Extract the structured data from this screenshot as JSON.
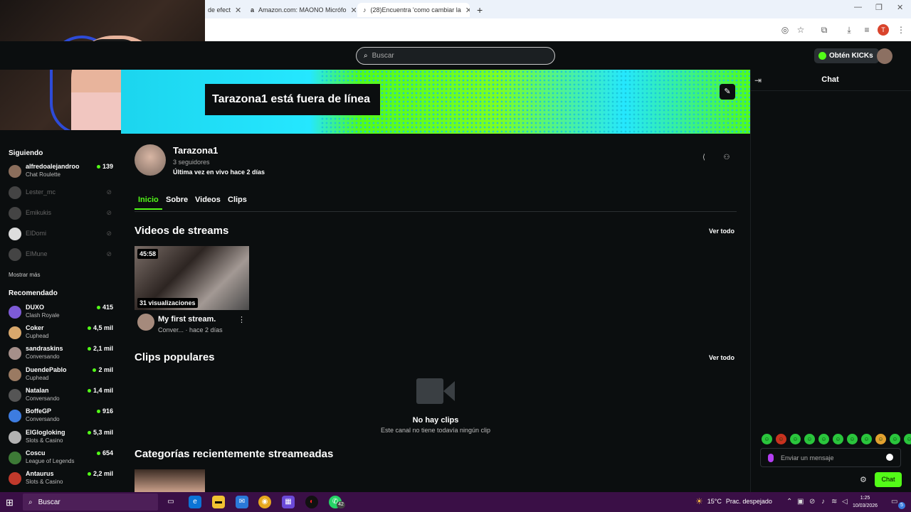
{
  "browser": {
    "tabs": [
      {
        "label": "de efect"
      },
      {
        "label": "Amazon.com: MAONO Micrófo"
      },
      {
        "label": "(28)Encuentra 'como cambiar la"
      }
    ],
    "new_tab": "+"
  },
  "header": {
    "search_placeholder": "Buscar",
    "kicks_label": "Obtén KICKs"
  },
  "banner": {
    "offline_text": "Tarazona1 está fuera de línea"
  },
  "sidebar": {
    "following_title": "Siguiendo",
    "following": [
      {
        "name": "alfredoalejandroo",
        "category": "Chat Roulette",
        "viewers": "139",
        "live": true
      },
      {
        "name": "Lester_mc",
        "live": false
      },
      {
        "name": "Emikukis",
        "live": false
      },
      {
        "name": "ElDomi",
        "live": false
      },
      {
        "name": "ElMune",
        "live": false
      }
    ],
    "show_more": "Mostrar más",
    "recommended_title": "Recomendado",
    "recommended": [
      {
        "name": "DUXO",
        "category": "Clash Royale",
        "viewers": "415"
      },
      {
        "name": "Coker",
        "category": "Cuphead",
        "viewers": "4,5 mil"
      },
      {
        "name": "sandraskins",
        "category": "Conversando",
        "viewers": "2,1 mil"
      },
      {
        "name": "DuendePablo",
        "category": "Cuphead",
        "viewers": "2 mil"
      },
      {
        "name": "Natalan",
        "category": "Conversando",
        "viewers": "1,4 mil"
      },
      {
        "name": "BoffeGP",
        "category": "Conversando",
        "viewers": "916"
      },
      {
        "name": "ElGlogloking",
        "category": "Slots & Casino",
        "viewers": "5,3 mil"
      },
      {
        "name": "Coscu",
        "category": "League of Legends",
        "viewers": "654"
      },
      {
        "name": "Antaurus",
        "category": "Slots & Casino",
        "viewers": "2,2 mil"
      }
    ]
  },
  "profile": {
    "name": "Tarazona1",
    "followers": "3 seguidores",
    "last_live": "Última vez en vivo hace 2 días"
  },
  "tabs": [
    "Inicio",
    "Sobre",
    "Videos",
    "Clips"
  ],
  "streams_section": {
    "title": "Videos de streams",
    "see_all": "Ver todo",
    "video": {
      "duration": "45:58",
      "views": "31 visualizaciones",
      "title": "My first stream.",
      "category": "Conver...",
      "time": "· hace 2 días"
    }
  },
  "clips_section": {
    "title": "Clips populares",
    "see_all": "Ver todo",
    "empty_title": "No hay clips",
    "empty_sub": "Este canal no tiene todavía ningún clip"
  },
  "categories_section": {
    "title": "Categorías recientemente streameadas"
  },
  "chat": {
    "title": "Chat",
    "input_placeholder": "Enviar un mensaje",
    "send_label": "Chat"
  },
  "taskbar": {
    "search_label": "Buscar",
    "badge_count": "42",
    "temperature": "15°C",
    "weather": "Prac. despejado",
    "time": "1:25",
    "date": "10/03/2026",
    "notifications": "5"
  },
  "colors": {
    "accent": "#53fc18",
    "background": "#0b0e0f",
    "taskbar": "#3a0f46"
  }
}
